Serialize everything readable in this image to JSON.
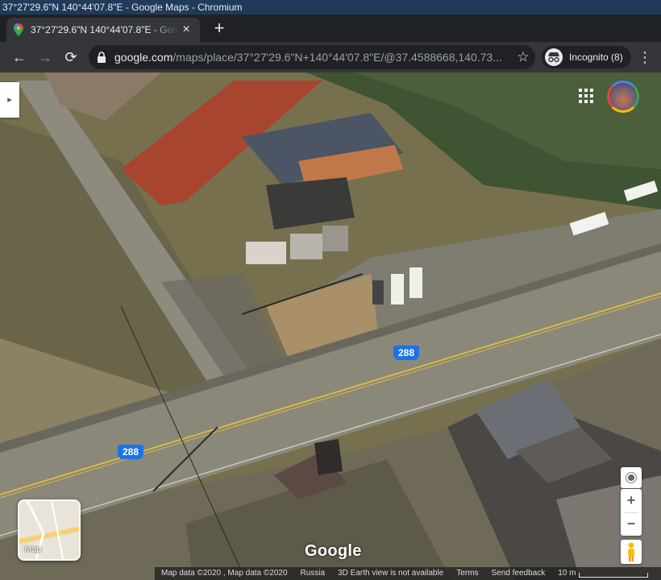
{
  "window": {
    "title": "37°27'29.6\"N 140°44'07.8\"E - Google Maps - Chromium"
  },
  "tab": {
    "title": "37°27'29.6\"N 140°44'07.8\"E - Google Maps",
    "close": "×"
  },
  "new_tab": "+",
  "nav": {
    "back": "←",
    "forward": "→",
    "reload": "⟳"
  },
  "address": {
    "host": "google.com",
    "path": "/maps/place/37°27'29.6\"N+140°44'07.8\"E/@37.4588668,140.73..."
  },
  "bookmark_star": "☆",
  "incognito": {
    "label": "Incognito (8)"
  },
  "menu": "⋮",
  "map": {
    "side_panel_toggle": "▸",
    "road_shields": [
      "288",
      "288"
    ],
    "layer_button": {
      "label": "Map"
    },
    "zoom_in": "+",
    "zoom_out": "−",
    "logo": "Google",
    "footer": {
      "data": "Map data ©2020 , Map data ©2020",
      "region": "Russia",
      "earth_note": "3D Earth view is not available",
      "terms": "Terms",
      "feedback": "Send feedback",
      "scale": "10 m"
    }
  },
  "icons": {
    "favicon": "google-maps-pin-icon",
    "lock": "lock-icon",
    "incognito": "incognito-icon",
    "apps": "apps-grid-icon",
    "locate": "my-location-icon",
    "pegman": "pegman-icon"
  }
}
